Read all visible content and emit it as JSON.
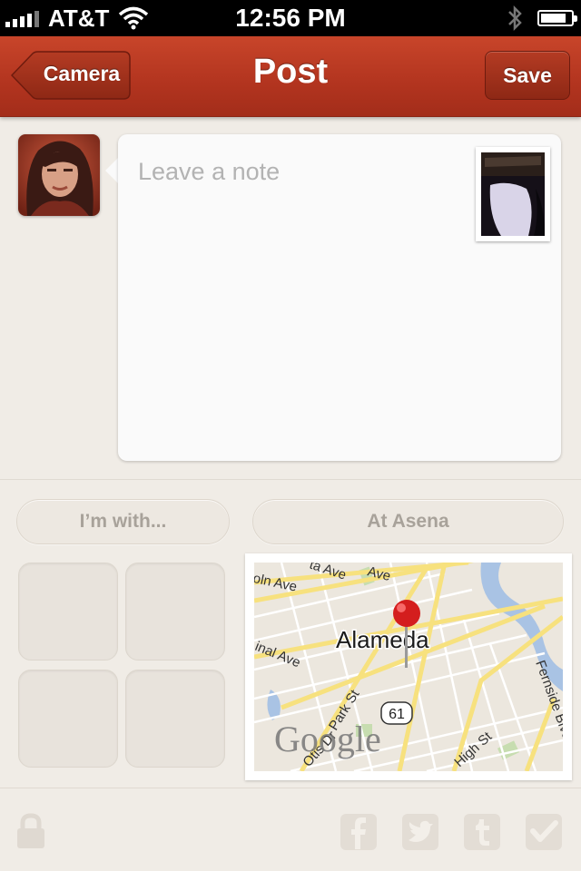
{
  "status_bar": {
    "carrier": "AT&T",
    "time": "12:56 PM",
    "battery_level": 0.85,
    "icons": [
      "signal-icon",
      "wifi-icon",
      "bluetooth-icon",
      "battery-icon"
    ]
  },
  "nav": {
    "title": "Post",
    "back_label": "Camera",
    "save_label": "Save"
  },
  "note": {
    "placeholder": "Leave a note",
    "value": ""
  },
  "tags": {
    "with_label": "I’m with...",
    "location_label": "At Asena"
  },
  "friends": {
    "slot_count": 4
  },
  "map": {
    "place_label": "Alameda",
    "route_number": "61",
    "attribution": "Google",
    "streets": [
      "Lincoln Ave",
      "Santa Clara Ave",
      "Encinal Ave",
      "Park St",
      "Otis Dr",
      "High St",
      "Fernside Blvd"
    ]
  },
  "footer": {
    "icons": [
      "lock-icon",
      "facebook-icon",
      "twitter-icon",
      "tumblr-icon",
      "checkin-icon"
    ]
  },
  "colors": {
    "nav_red": "#b2341f",
    "background": "#f0ece6",
    "pill_text": "#a8a29a",
    "pin_red": "#d41e1e"
  }
}
